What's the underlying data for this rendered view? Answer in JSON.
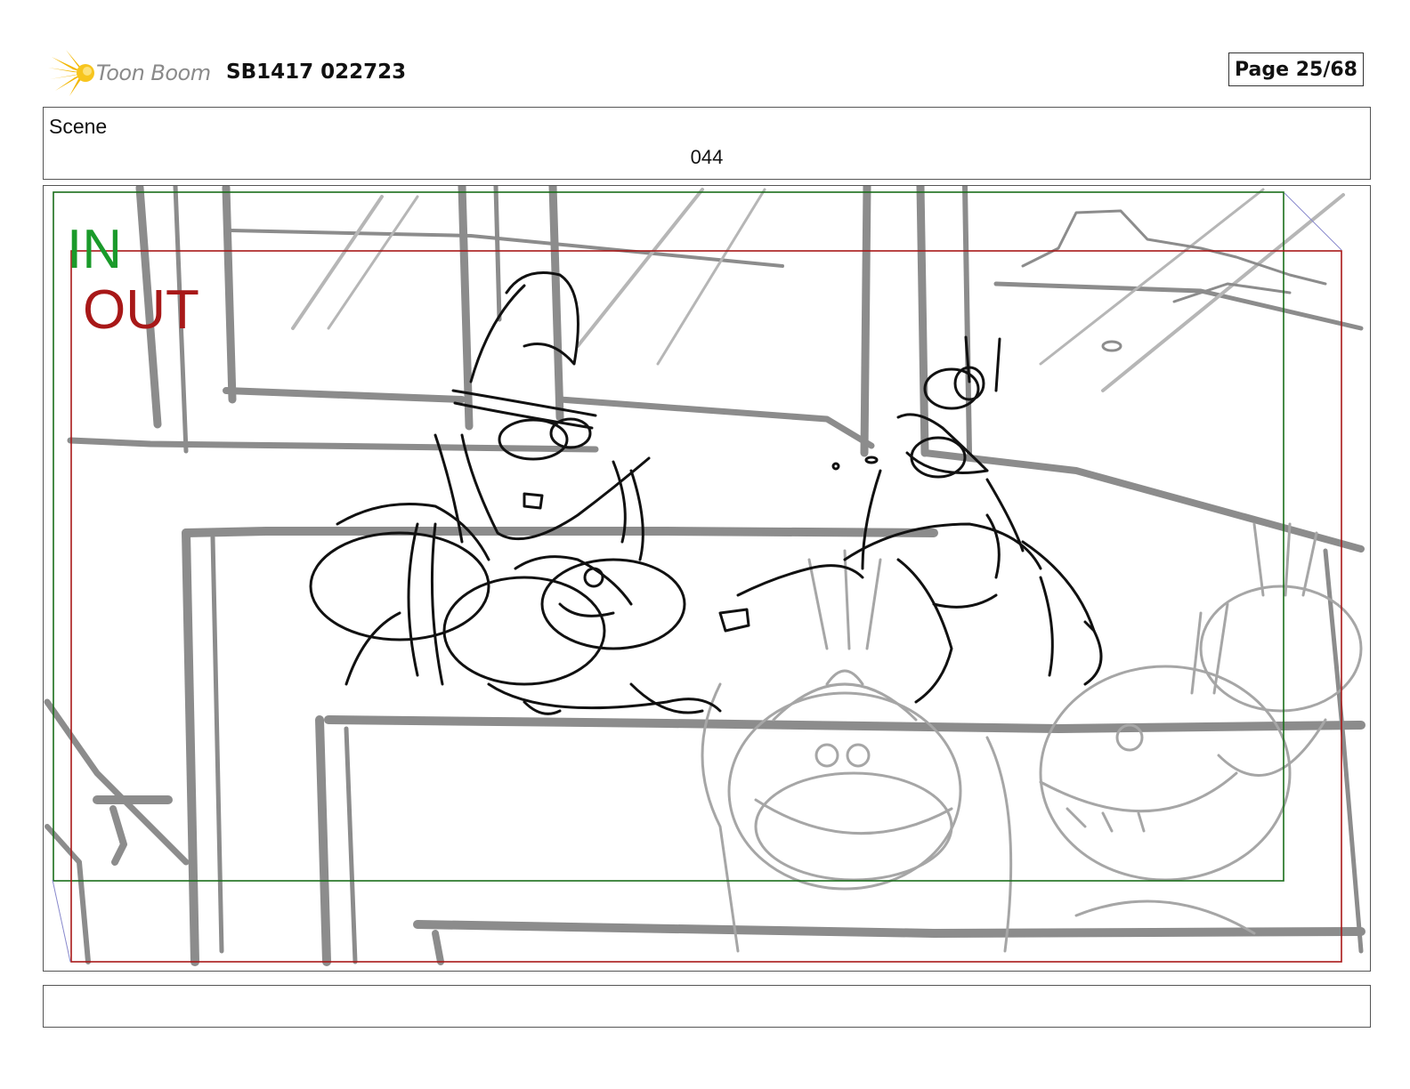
{
  "header": {
    "brand": "Toon Boom",
    "document_id": "SB1417 022723",
    "page_label": "Page 25/68"
  },
  "scene": {
    "label": "Scene",
    "number": "044"
  },
  "panel": {
    "frame_in_label": "IN",
    "frame_out_label": "OUT",
    "frame_in_color": "#1a9a2a",
    "frame_out_color": "#a81818"
  },
  "notes": {
    "text": ""
  },
  "icons": {
    "brand_logo": "toon-boom-starburst-icon"
  }
}
